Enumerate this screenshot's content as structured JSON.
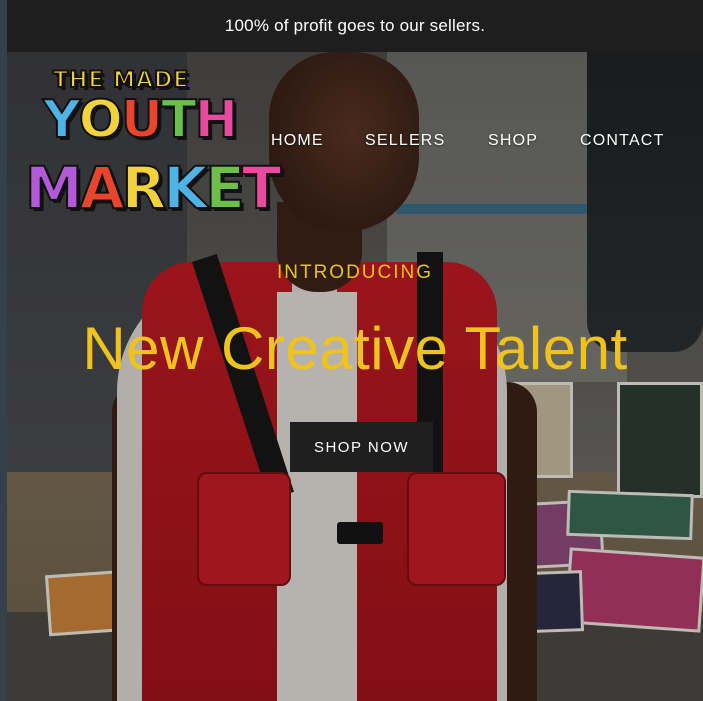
{
  "announcement": {
    "text": "100% of profit goes to our sellers."
  },
  "logo": {
    "line1": "THE MADE",
    "line2": "YOUTH",
    "line3": "MARKET",
    "line2_colors": [
      "#4fb3e8",
      "#f2d33b",
      "#e8452c",
      "#6cc04a",
      "#e84aa0"
    ],
    "line3_colors": [
      "#b25ad8",
      "#e8452c",
      "#f2d33b",
      "#4fb3e8",
      "#6cc04a",
      "#e84aa0"
    ]
  },
  "nav": {
    "items": [
      {
        "label": "HOME"
      },
      {
        "label": "SELLERS"
      },
      {
        "label": "SHOP"
      },
      {
        "label": "CONTACT"
      }
    ]
  },
  "hero": {
    "kicker": "INTRODUCING",
    "title": "New Creative Talent",
    "cta_label": "SHOP NOW",
    "accent_color": "#efc31c",
    "button_color": "#1f1f1f"
  }
}
